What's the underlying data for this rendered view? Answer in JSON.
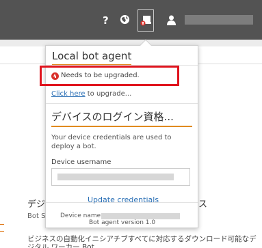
{
  "topbar": {
    "help_icon": "?",
    "icons": [
      "help-icon",
      "globe-icon",
      "bot-agent-upgrade-icon",
      "user-icon"
    ],
    "accent_color": "#e0141e"
  },
  "background": {
    "heading_left": "デジ",
    "heading_right": "ス",
    "sub_left": "Bot S",
    "description": "ビジネスの自動化イニシアチブすべてに対応するダウンロード可能なデジタル ワーカー Bot"
  },
  "popup": {
    "title": "Local bot agent",
    "status_text": "Needs to be upgraded.",
    "upgrade_link": "Click here",
    "upgrade_suffix": " to upgrade...",
    "login_heading": "デバイスのログイン資格...",
    "credentials_text": "Your device credentials are used to deploy a bot.",
    "device_username_label": "Device username",
    "update_button": "Update credentials",
    "device_name_label": "Device name",
    "agent_version": "Bot agent version 1.0",
    "accent_color": "#e08a1e",
    "link_color": "#2a6fb5"
  }
}
